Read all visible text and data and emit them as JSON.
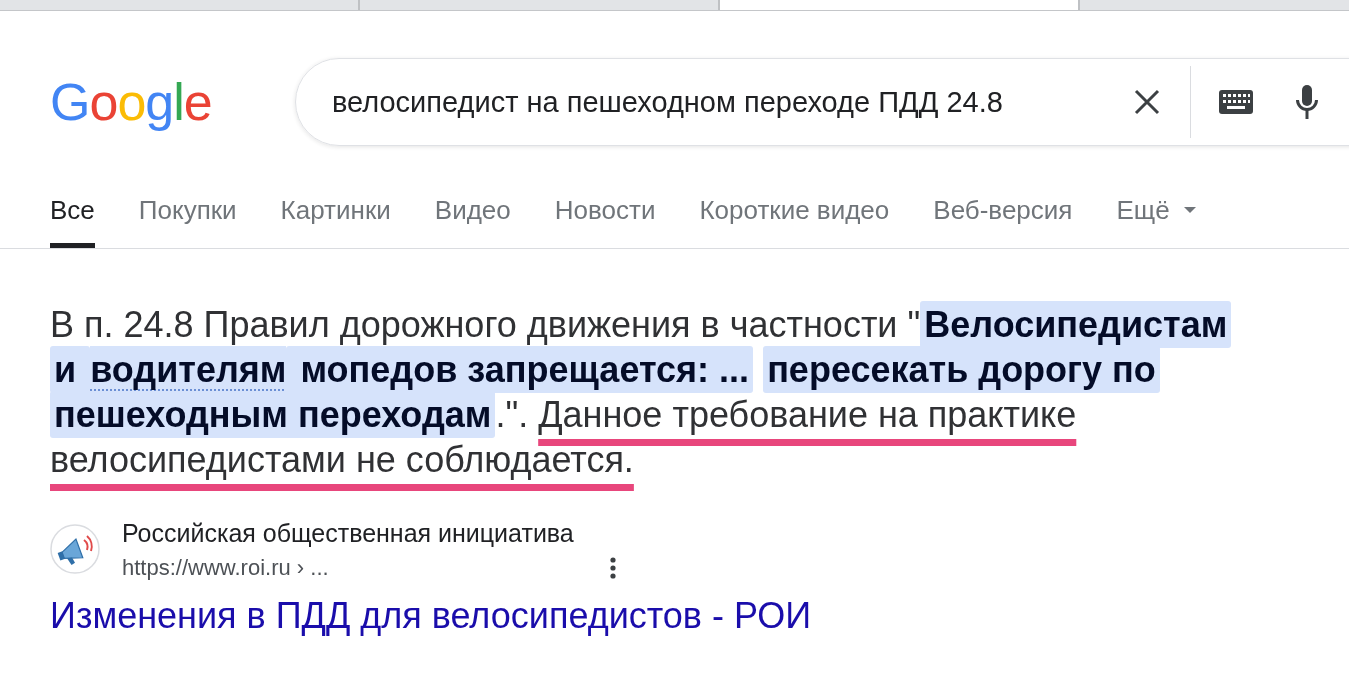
{
  "browser_tabs": [
    {
      "selected": false
    },
    {
      "selected": false
    },
    {
      "selected": true
    },
    {
      "selected": false
    }
  ],
  "logo": "Google",
  "search": {
    "value": "велосипедист на пешеходном переходе ПДД 24.8"
  },
  "tabs": [
    {
      "label": "Все",
      "selected": true,
      "kind": "tab"
    },
    {
      "label": "Покупки",
      "selected": false,
      "kind": "tab"
    },
    {
      "label": "Картинки",
      "selected": false,
      "kind": "tab"
    },
    {
      "label": "Видео",
      "selected": false,
      "kind": "tab"
    },
    {
      "label": "Новости",
      "selected": false,
      "kind": "tab"
    },
    {
      "label": "Короткие видео",
      "selected": false,
      "kind": "tab"
    },
    {
      "label": "Веб-версия",
      "selected": false,
      "kind": "tab"
    },
    {
      "label": "Ещё",
      "selected": false,
      "kind": "menu"
    }
  ],
  "snippet": {
    "segments": [
      {
        "kind": "plain",
        "text": "В п. 24.8 Правил дорожного движения в частности \""
      },
      {
        "kind": "highlight",
        "text": "Велосипедистам и "
      },
      {
        "kind": "term",
        "text": "водителям"
      },
      {
        "kind": "highlight",
        "text": " мопедов запрещается: ..."
      },
      {
        "kind": "highlight",
        "text": "пересекать дорогу по пешеходным переходам"
      },
      {
        "kind": "plain",
        "text": ".\". "
      },
      {
        "kind": "marked",
        "text": "Данное требование на практике велосипедистами не соблюдается."
      }
    ]
  },
  "result": {
    "site_name": "Российская общественная инициатива",
    "url": "https://www.roi.ru › ...",
    "title": "Изменения в ПДД для велосипедистов - РОИ"
  }
}
